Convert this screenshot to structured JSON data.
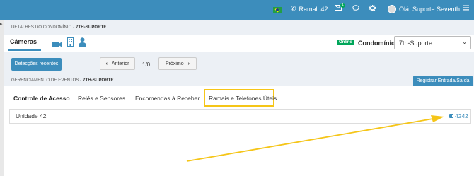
{
  "topbar": {
    "ramal_label": "Ramal: 42",
    "greeting": "Olá, Suporte Seventh",
    "notification_count": "1"
  },
  "condominio_panel": {
    "breadcrumb_prefix": "DETALHES DO CONDOMÍNIO - ",
    "breadcrumb_name": "7TH-SUPORTE",
    "tab_cameras": "Câmeras",
    "online_badge": "Online",
    "condominio_label": "Condomínio:",
    "condominio_selected": "7th-Suporte",
    "recent_detections_button": "Detecções recentes",
    "pager": {
      "prev_label": "Anterior",
      "page_text": "1/0",
      "next_label": "Próximo"
    }
  },
  "eventos_panel": {
    "breadcrumb_prefix": "GERENCIAMENTO DE EVENTOS - ",
    "breadcrumb_name": "7TH-SUPORTE",
    "register_button": "Registrar Entrada/Saída",
    "tabs": [
      {
        "label": "Controle de Acesso",
        "active": true
      },
      {
        "label": "Relés e Sensores",
        "active": false
      },
      {
        "label": "Encomendas à Receber",
        "active": false
      },
      {
        "label": "Ramais e Telefones Úteis",
        "active": false,
        "highlighted": true
      }
    ],
    "entry": {
      "unit_label": "Unidade 42",
      "extension": "4242"
    }
  },
  "colors": {
    "primary": "#3c8dbc",
    "online": "#00a65a",
    "highlight": "#f5c518"
  }
}
